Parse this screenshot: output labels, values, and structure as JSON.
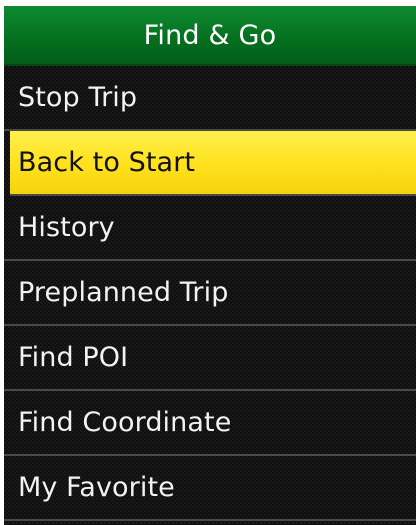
{
  "title_bar": {
    "title": "Find & Go",
    "color": "#0b7a2a"
  },
  "menu": {
    "selected_index": 1,
    "highlight_color": "#ffe21f",
    "items": [
      {
        "label": "Stop Trip"
      },
      {
        "label": "Back to Start"
      },
      {
        "label": "History"
      },
      {
        "label": "Preplanned Trip"
      },
      {
        "label": "Find POI"
      },
      {
        "label": "Find Coordinate"
      },
      {
        "label": "My Favorite"
      }
    ]
  }
}
